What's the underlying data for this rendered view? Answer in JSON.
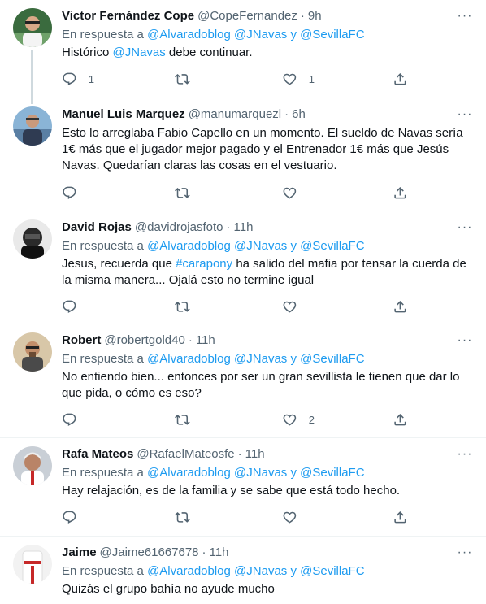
{
  "in_reply_prefix": "En respuesta a",
  "tweets": [
    {
      "name": "Victor Fernández Cope",
      "handle": "@CopeFernandez",
      "time": "9h",
      "mentions": [
        "@Alvaradoblog",
        "@JNavas",
        "@SevillaFC"
      ],
      "text_parts": [
        "Histórico ",
        "@JNavas",
        " debe continuar."
      ],
      "replies": "1",
      "retweets": "",
      "likes": "1"
    },
    {
      "name": "Manuel Luis Marquez",
      "handle": "@manumarquezl",
      "time": "6h",
      "text": "Esto lo arreglaba Fabio Capello en un momento. El sueldo de Navas sería 1€ más que el jugador mejor pagado y el Entrenador 1€ más que Jesús Navas. Quedarían claras las cosas en el vestuario.",
      "replies": "",
      "retweets": "",
      "likes": ""
    },
    {
      "name": "David Rojas",
      "handle": "@davidrojasfoto",
      "time": "11h",
      "mentions": [
        "@Alvaradoblog",
        "@JNavas",
        "@SevillaFC"
      ],
      "text_parts": [
        "Jesus, recuerda que ",
        "#carapony",
        " ha salido del mafia por tensar la cuerda de la misma manera...  Ojalá esto no termine igual"
      ],
      "replies": "",
      "retweets": "",
      "likes": ""
    },
    {
      "name": "Robert",
      "handle": "@robertgold40",
      "time": "11h",
      "mentions": [
        "@Alvaradoblog",
        "@JNavas",
        "@SevillaFC"
      ],
      "text": "No entiendo bien... entonces por ser un gran sevillista le tienen que dar lo que pida, o cómo es eso?",
      "replies": "",
      "retweets": "",
      "likes": "2"
    },
    {
      "name": "Rafa Mateos",
      "handle": "@RafaelMateosfe",
      "time": "11h",
      "mentions": [
        "@Alvaradoblog",
        "@JNavas",
        "@SevillaFC"
      ],
      "text": "Hay relajación, es de la familia y se sabe que está todo hecho.",
      "replies": "",
      "retweets": "",
      "likes": ""
    },
    {
      "name": "Jaime",
      "handle": "@Jaime61667678",
      "time": "11h",
      "mentions": [
        "@Alvaradoblog",
        "@JNavas",
        "@SevillaFC"
      ],
      "text": "Quizás el grupo bahía no ayude mucho"
    }
  ],
  "conjunction": "y",
  "colors": {
    "link": "#1d9bf0",
    "muted": "#536471",
    "text": "#0f1419",
    "divider": "#eff3f4"
  },
  "icons": {
    "reply": "reply-icon",
    "retweet": "retweet-icon",
    "like": "like-icon",
    "share": "share-icon",
    "more": "more-icon"
  }
}
